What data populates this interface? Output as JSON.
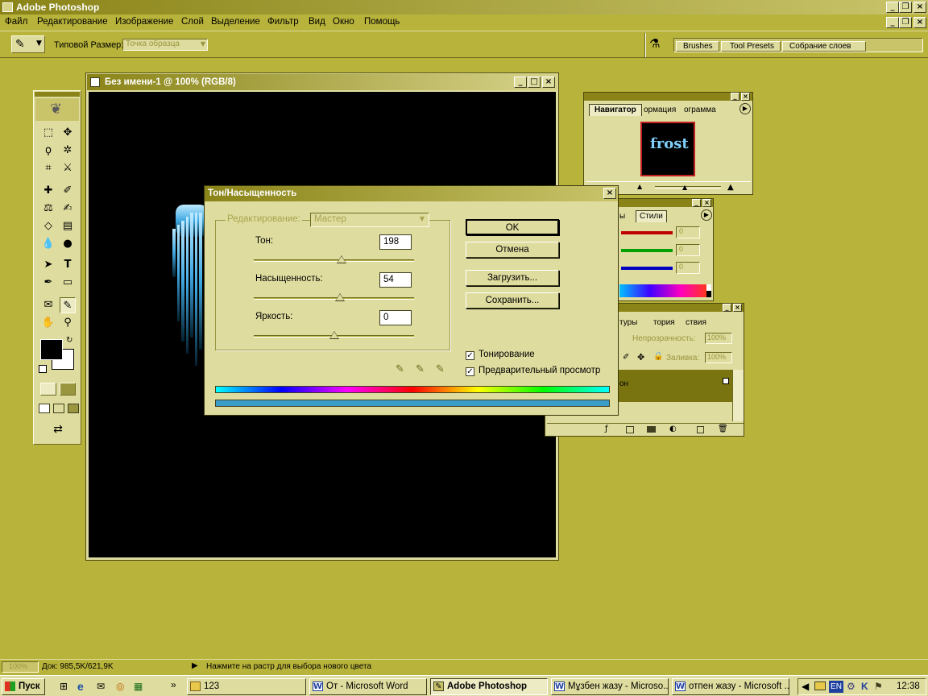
{
  "app": {
    "title": "Adobe Photoshop"
  },
  "menu": [
    "Файл",
    "Редактирование",
    "Изображение",
    "Слой",
    "Выделение",
    "Фильтр",
    "Вид",
    "Окно",
    "Помощь"
  ],
  "options": {
    "sample_label": "Типовой Размер:",
    "sample_value": "Точка образца",
    "well_tabs": [
      "Brushes",
      "Tool Presets",
      "Собрание слоев"
    ]
  },
  "document": {
    "title": "Без имени-1 @ 100% (RGB/8)"
  },
  "navigator": {
    "tabs": [
      "Навигатор",
      "ормация",
      "ограмма"
    ],
    "preview_text": "frost"
  },
  "color_palette": {
    "tabs": [
      "ы",
      "Стили"
    ],
    "values": [
      "0",
      "0",
      "0"
    ],
    "colors": {
      "red": "#c00000",
      "green": "#00a000",
      "blue": "#0000c0"
    }
  },
  "layers_palette": {
    "tabs": [
      "туры",
      "тория",
      "ствия"
    ],
    "opacity_label": "Непрозрачность:",
    "opacity_value": "100%",
    "fill_label": "Заливка:",
    "fill_value": "100%",
    "layer_name": "он"
  },
  "dialog": {
    "title": "Тон/Насыщенность",
    "edit_label": "Редактирование:",
    "edit_value": "Мастер",
    "hue_label": "Тон:",
    "hue_value": "198",
    "hue_fraction": 0.55,
    "saturation_label": "Насыщенность:",
    "saturation_value": "54",
    "saturation_fraction": 0.54,
    "lightness_label": "Яркость:",
    "lightness_value": "0",
    "lightness_fraction": 0.5,
    "ok": "OK",
    "cancel": "Отмена",
    "load": "Загрузить...",
    "save": "Сохранить...",
    "colorize": "Тонирование",
    "preview": "Предварительный просмотр",
    "colorize_checked": true,
    "preview_checked": true,
    "result_bar_color": "#3a9ec8"
  },
  "status": {
    "zoom": "100%",
    "doc": "Док: 985,5K/621,9K",
    "hint": "Нажмите на растр для выбора нового цвета"
  },
  "taskbar": {
    "start": "Пуск",
    "more": "»",
    "items": [
      "123",
      "От - Microsoft Word",
      "Adobe Photoshop",
      "Мұзбен жазу - Microso...",
      "отпен жазу - Microsoft ..."
    ],
    "lang": "EN",
    "time": "12:38"
  },
  "colors": {
    "workspace": "#b8b33a",
    "panel": "#dedc9e",
    "titlebar": "#8a8418"
  }
}
